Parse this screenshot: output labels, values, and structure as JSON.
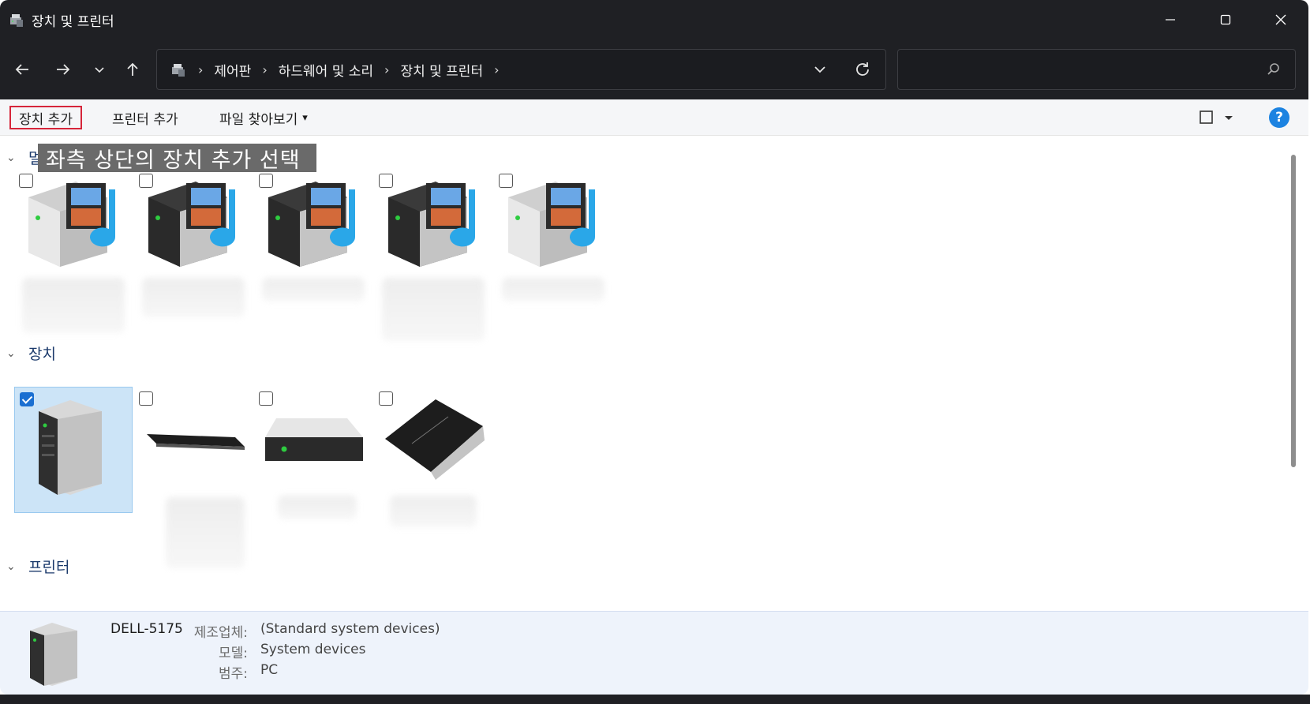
{
  "window": {
    "title": "장치 및 프린터",
    "icon": "devices-printers-icon",
    "controls": [
      "minimize-icon",
      "maximize-icon",
      "close-icon"
    ]
  },
  "address": {
    "breadcrumb": [
      "제어판",
      "하드웨어 및 소리",
      "장치 및 프린터"
    ],
    "separator": "›",
    "search_placeholder": ""
  },
  "toolbar": {
    "add_device": "장치 추가",
    "add_printer": "프린터 추가",
    "browse_files": "파일 찾아보기",
    "dropdown_arrow": "▾"
  },
  "annotation": {
    "caption": "좌측 상단의 장치 추가  선택"
  },
  "groups": {
    "multimedia": {
      "label": "멀",
      "tiles": [
        {
          "icon": "media-device-icon",
          "checked": false
        },
        {
          "icon": "media-device-icon",
          "checked": false
        },
        {
          "icon": "media-device-icon",
          "checked": false
        },
        {
          "icon": "media-device-icon",
          "checked": false
        },
        {
          "icon": "media-device-icon",
          "checked": false
        }
      ]
    },
    "devices": {
      "label": "장치",
      "tiles": [
        {
          "icon": "computer-tower-icon",
          "checked": true
        },
        {
          "icon": "keyboard-icon",
          "checked": false
        },
        {
          "icon": "external-drive-icon",
          "checked": false
        },
        {
          "icon": "mouse-icon",
          "checked": false
        }
      ]
    },
    "printers": {
      "label": "프린터"
    }
  },
  "details": {
    "name": "DELL-5175",
    "manufacturer_label": "제조업체:",
    "manufacturer_value": "(Standard system devices)",
    "model_label": "모델:",
    "model_value": "System devices",
    "category_label": "범주:",
    "category_value": "PC"
  },
  "colors": {
    "titlebar": "#1f2024",
    "highlight_border": "#d6253a",
    "selected_tile": "#cce4f7",
    "help_blue": "#1c83e1"
  }
}
